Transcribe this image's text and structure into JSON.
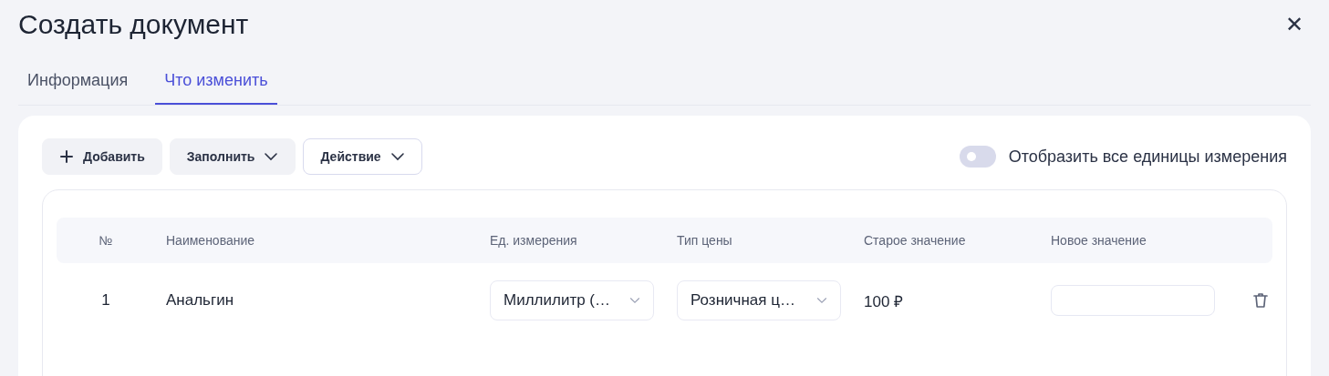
{
  "window": {
    "title": "Создать документ",
    "close": "✕"
  },
  "tabs": [
    {
      "label": "Информация",
      "selected": false
    },
    {
      "label": "Что изменить",
      "selected": true
    }
  ],
  "toolbar": {
    "buttons": [
      {
        "label": "Добавить",
        "kind": "add"
      },
      {
        "label": "Заполнить",
        "kind": "menu"
      },
      {
        "label": "Действие",
        "kind": "menu-outline"
      }
    ],
    "toggle": {
      "label": "Отобразить все единицы измерения",
      "on": false
    }
  },
  "table": {
    "columns": [
      "№",
      "Наименование",
      "Ед. измерения",
      "Тип цены",
      "Старое значение",
      "Новое значение"
    ],
    "rows": [
      {
        "number": "1",
        "name": "Анальгин",
        "unit": "Миллилитр (…",
        "price_type": "Розничная ц…",
        "old_value": "100 ₽",
        "new_value": ""
      }
    ]
  }
}
